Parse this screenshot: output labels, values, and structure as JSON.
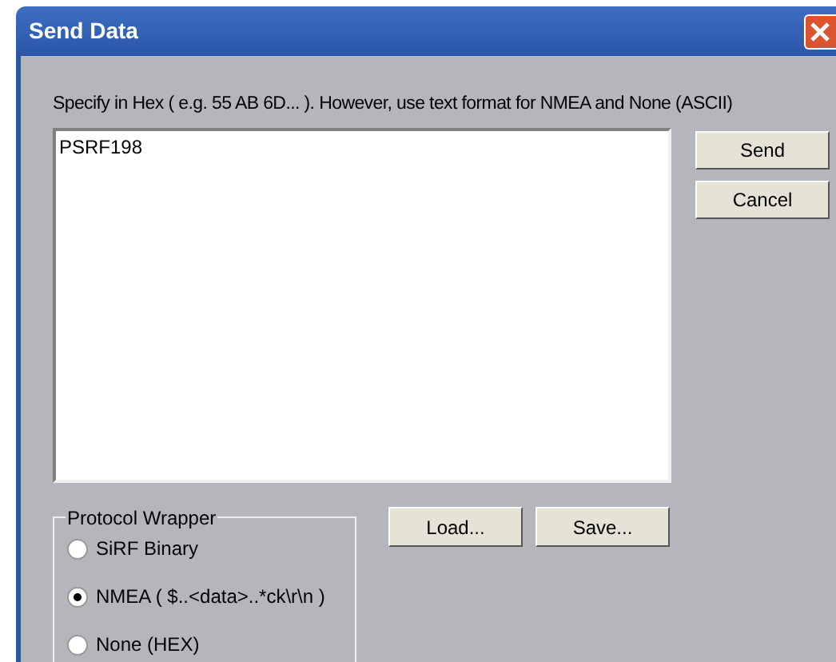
{
  "window": {
    "title": "Send Data"
  },
  "instruction": "Specify in Hex ( e.g. 55 AB 6D... ).  However, use text format for NMEA and None (ASCII)",
  "data_field": {
    "value": "PSRF198"
  },
  "buttons": [
    "Send",
    "Cancel"
  ],
  "file_buttons": [
    "Load...",
    "Save..."
  ],
  "protocol_wrapper": {
    "title": "Protocol Wrapper",
    "options": [
      {
        "label": "SiRF Binary",
        "selected": false
      },
      {
        "label": "NMEA ( $..<data>..*ck\\r\\n )",
        "selected": true
      },
      {
        "label": "None (HEX)",
        "selected": false
      }
    ]
  }
}
